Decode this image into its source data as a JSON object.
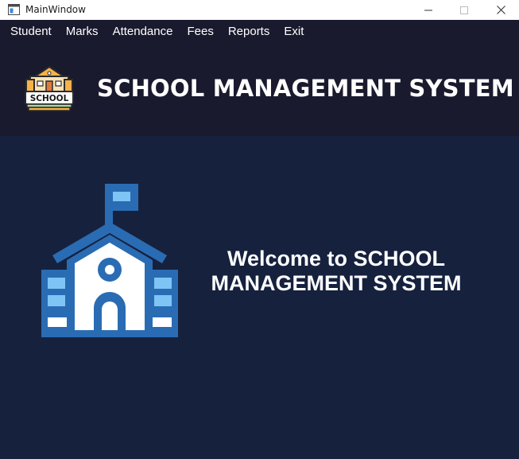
{
  "window": {
    "title": "MainWindow",
    "controls": {
      "minimize_icon": "minimize-icon",
      "maximize_icon": "maximize-icon",
      "close_icon": "close-icon"
    }
  },
  "menu": {
    "items": [
      "Student",
      "Marks",
      "Attendance",
      "Fees",
      "Reports",
      "Exit"
    ]
  },
  "header": {
    "logo_text": "SCHOOL",
    "title": "SCHOOL MANAGEMENT SYSTEM"
  },
  "main": {
    "welcome_line1": "Welcome to SCHOOL",
    "welcome_line2": "MANAGEMENT SYSTEM"
  },
  "colors": {
    "menu_bg": "#1a1a2e",
    "main_bg": "#16213e",
    "illustration_blue": "#2a6cb3",
    "illustration_light": "#7ec4f5",
    "logo_orange": "#f6b24a"
  }
}
